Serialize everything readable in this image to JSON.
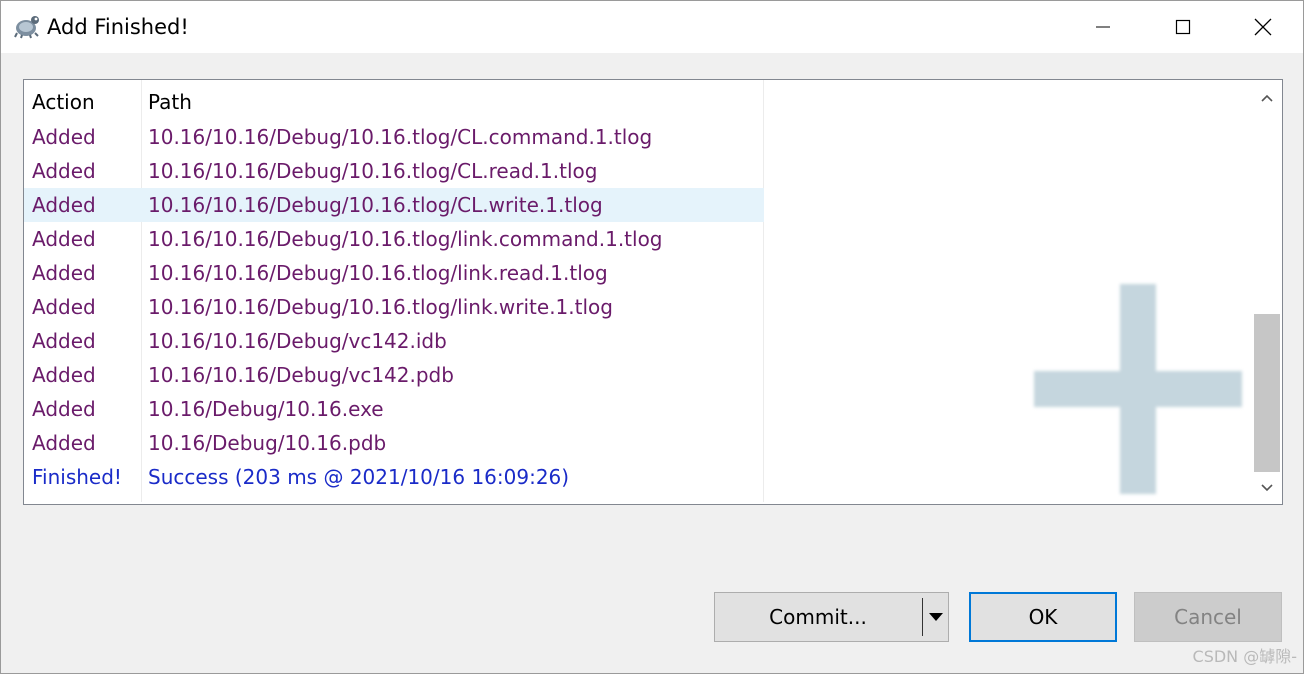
{
  "window": {
    "title": "Add Finished!"
  },
  "list": {
    "columns": [
      "Action",
      "Path"
    ],
    "rows": [
      {
        "action": "Added",
        "path": "10.16/10.16/Debug/10.16.tlog/CL.command.1.tlog"
      },
      {
        "action": "Added",
        "path": "10.16/10.16/Debug/10.16.tlog/CL.read.1.tlog"
      },
      {
        "action": "Added",
        "path": "10.16/10.16/Debug/10.16.tlog/CL.write.1.tlog"
      },
      {
        "action": "Added",
        "path": "10.16/10.16/Debug/10.16.tlog/link.command.1.tlog"
      },
      {
        "action": "Added",
        "path": "10.16/10.16/Debug/10.16.tlog/link.read.1.tlog"
      },
      {
        "action": "Added",
        "path": "10.16/10.16/Debug/10.16.tlog/link.write.1.tlog"
      },
      {
        "action": "Added",
        "path": "10.16/10.16/Debug/vc142.idb"
      },
      {
        "action": "Added",
        "path": "10.16/10.16/Debug/vc142.pdb"
      },
      {
        "action": "Added",
        "path": "10.16/Debug/10.16.exe"
      },
      {
        "action": "Added",
        "path": "10.16/Debug/10.16.pdb"
      },
      {
        "action": "Finished!",
        "path": "Success (203 ms @ 2021/10/16 16:09:26)"
      }
    ],
    "selected_row": "10.16/10.16/Debug/10.16.tlog/CL.write.1.tlog"
  },
  "buttons": {
    "commit": "Commit...",
    "ok": "OK",
    "cancel": "Cancel"
  },
  "watermark": "CSDN @罅隙-",
  "colors": {
    "added": "#6a1b6a",
    "finished": "#1a2bc8",
    "selection": "#e5f3fb",
    "focus_border": "#0078d7",
    "plus_watermark": "#c5d6de"
  },
  "icons": [
    "app-icon",
    "minimize-icon",
    "maximize-icon",
    "close-icon",
    "scroll-up-icon",
    "scroll-down-icon",
    "dropdown-arrow-icon",
    "add-plus-icon"
  ]
}
